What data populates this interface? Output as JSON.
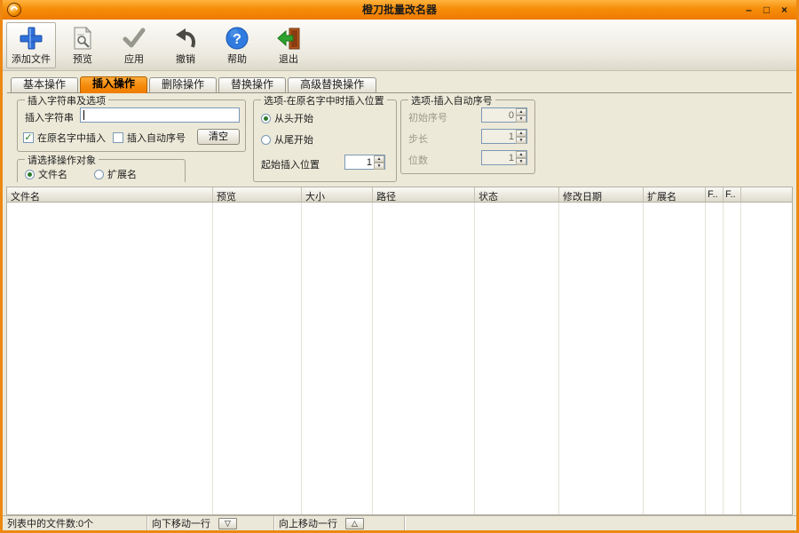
{
  "window": {
    "title": "橙刀批量改名器",
    "minimize": "–",
    "maximize": "□",
    "close": "×"
  },
  "toolbar": {
    "items": [
      {
        "label": "添加文件",
        "icon": "add-file-icon"
      },
      {
        "label": "预览",
        "icon": "preview-icon"
      },
      {
        "label": "应用",
        "icon": "apply-icon"
      },
      {
        "label": "撤销",
        "icon": "undo-icon"
      },
      {
        "label": "帮助",
        "icon": "help-icon"
      },
      {
        "label": "退出",
        "icon": "exit-icon"
      }
    ]
  },
  "tabs": [
    {
      "label": "基本操作",
      "active": false
    },
    {
      "label": "插入操作",
      "active": true
    },
    {
      "label": "删除操作",
      "active": false
    },
    {
      "label": "替换操作",
      "active": false
    },
    {
      "label": "高级替换操作",
      "active": false
    }
  ],
  "insert_group": {
    "title": "插入字符串及选项",
    "string_label": "插入字符串",
    "input_value": "",
    "checkbox_in_name": {
      "label": "在原名字中插入",
      "checked": true,
      "glyph": "✓"
    },
    "checkbox_auto_num": {
      "label": "插入自动序号",
      "checked": false
    },
    "clear_button": "清空"
  },
  "target_group": {
    "title": "请选择操作对象",
    "radio_filename": {
      "label": "文件名",
      "selected": true
    },
    "radio_extension": {
      "label": "扩展名",
      "selected": false
    }
  },
  "position_group": {
    "title": "选项-在原名字中时插入位置",
    "radio_from_start": {
      "label": "从头开始",
      "selected": true
    },
    "radio_from_end": {
      "label": "从尾开始",
      "selected": false
    },
    "start_pos_label": "起始插入位置",
    "start_pos_value": "1"
  },
  "autonum_group": {
    "title": "选项-插入自动序号",
    "rows": [
      {
        "label": "初始序号",
        "value": "0"
      },
      {
        "label": "步长",
        "value": "1"
      },
      {
        "label": "位数",
        "value": "1"
      }
    ]
  },
  "spinner": {
    "up": "▲",
    "down": "▼"
  },
  "table": {
    "columns": [
      "文件名",
      "预览",
      "大小",
      "路径",
      "状态",
      "修改日期",
      "扩展名",
      "F..",
      "F.."
    ]
  },
  "statusbar": {
    "file_count": "列表中的文件数:0个",
    "move_down": "向下移动一行",
    "move_up": "向上移动一行",
    "down_glyph": "▽",
    "up_glyph": "△"
  },
  "colors": {
    "accent_orange": "#f68d08",
    "active_tab": "#f58a0a",
    "window_border": "#ed8812"
  }
}
